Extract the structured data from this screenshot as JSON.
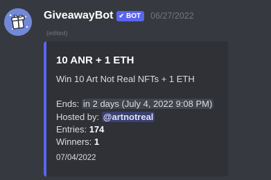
{
  "message": {
    "author": "GiveawayBot",
    "bot_badge": "BOT",
    "timestamp": "06/27/2022",
    "edited": "(edited)"
  },
  "embed": {
    "accent_color": "#5865f2",
    "title": "10 ANR + 1 ETH",
    "description": "Win 10 Art Not Real NFTs + 1 ETH",
    "ends_label": "Ends:",
    "ends_relative": "in 2 days",
    "ends_absolute": "July 4, 2022 9:08 PM",
    "hosted_by_label": "Hosted by:",
    "host_mention": "@artnotreal",
    "entries_label": "Entries:",
    "entries": "174",
    "winners_label": "Winners:",
    "winners": "1",
    "footer_date": "07/04/2022"
  }
}
